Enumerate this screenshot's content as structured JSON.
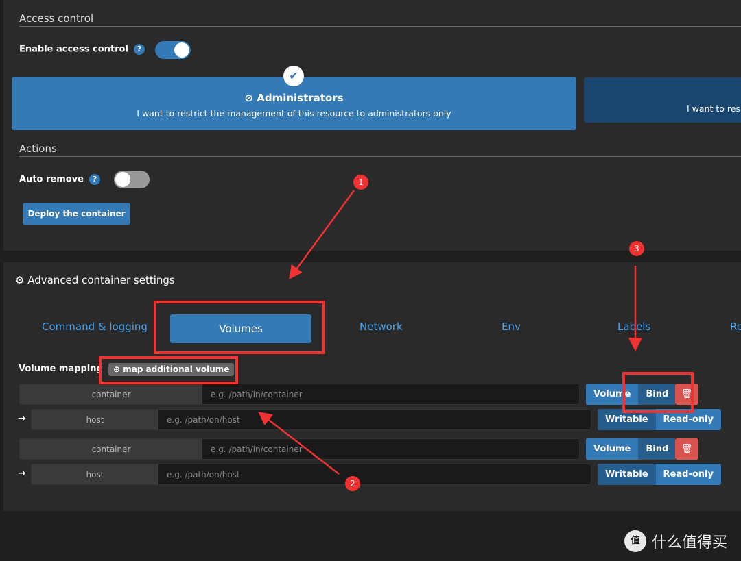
{
  "access": {
    "title": "Access control",
    "enable_label": "Enable access control",
    "enabled": true,
    "admin_title": "Administrators",
    "admin_desc": "I want to restrict the management of this resource to administrators only",
    "other_desc": "I want to res"
  },
  "actions": {
    "title": "Actions",
    "auto_remove_label": "Auto remove",
    "auto_remove": false,
    "deploy_label": "Deploy the container"
  },
  "advanced": {
    "title": "Advanced container settings",
    "tabs": [
      "Command & logging",
      "Volumes",
      "Network",
      "Env",
      "Labels",
      "Re"
    ],
    "active_tab": "Volumes",
    "volume_mapping_label": "Volume mapping",
    "add_volume_label": "map additional volume",
    "mappings": [
      {
        "container_label": "container",
        "container_placeholder": "e.g. /path/in/container",
        "host_label": "host",
        "host_placeholder": "e.g. /path/on/host",
        "type_options": [
          "Volume",
          "Bind"
        ],
        "type": "Bind",
        "mode_options": [
          "Writable",
          "Read-only"
        ],
        "mode": "Writable"
      },
      {
        "container_label": "container",
        "container_placeholder": "e.g. /path/in/container",
        "host_label": "host",
        "host_placeholder": "e.g. /path/on/host",
        "type_options": [
          "Volume",
          "Bind"
        ],
        "type": "Bind",
        "mode_options": [
          "Writable",
          "Read-only"
        ],
        "mode": "Writable"
      }
    ]
  },
  "annotations": [
    "1",
    "2",
    "3"
  ],
  "watermark": "什么值得买",
  "colors": {
    "primary": "#337ab7",
    "active": "#265d8c",
    "danger": "#d9534f",
    "annotation": "#f03232"
  }
}
